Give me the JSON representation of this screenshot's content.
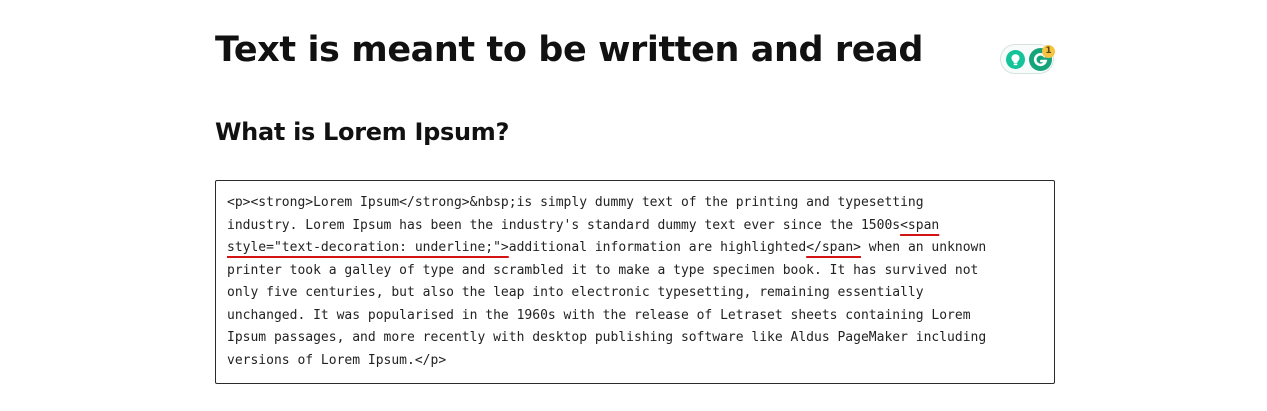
{
  "document": {
    "heading": "Text is meant to be written and read",
    "subheading": "What is Lorem Ipsum?"
  },
  "grammarly": {
    "badge_count": "1",
    "colors": {
      "bulb": "#15c39a",
      "logo": "#15a37a",
      "badge": "#f5c542"
    }
  },
  "code_block": {
    "lines": [
      [
        {
          "text": "<p><strong>Lorem Ipsum</strong>&nbsp;is simply dummy text of the printing and typesetting",
          "flag": false
        }
      ],
      [
        {
          "text": "industry. Lorem Ipsum has been the industry's standard dummy text ever since the 1500s",
          "flag": false
        },
        {
          "text": "<span",
          "flag": true
        }
      ],
      [
        {
          "text": "style=\"text-decoration: underline;\">",
          "flag": true
        },
        {
          "text": "additional information are highlighted",
          "flag": false
        },
        {
          "text": "</span>",
          "flag": true
        },
        {
          "text": " when an unknown",
          "flag": false
        }
      ],
      [
        {
          "text": "printer took a galley of type and scrambled it to make a type specimen book. It has survived not",
          "flag": false
        }
      ],
      [
        {
          "text": "only five centuries, but also the leap into electronic typesetting, remaining essentially",
          "flag": false
        }
      ],
      [
        {
          "text": "unchanged. It was popularised in the 1960s with the release of Letraset sheets containing Lorem",
          "flag": false
        }
      ],
      [
        {
          "text": "Ipsum passages, and more recently with desktop publishing software like Aldus PageMaker including",
          "flag": false
        }
      ],
      [
        {
          "text": "versions of Lorem Ipsum.</p>",
          "flag": false
        }
      ]
    ],
    "error_underline_color": "#d41414"
  }
}
